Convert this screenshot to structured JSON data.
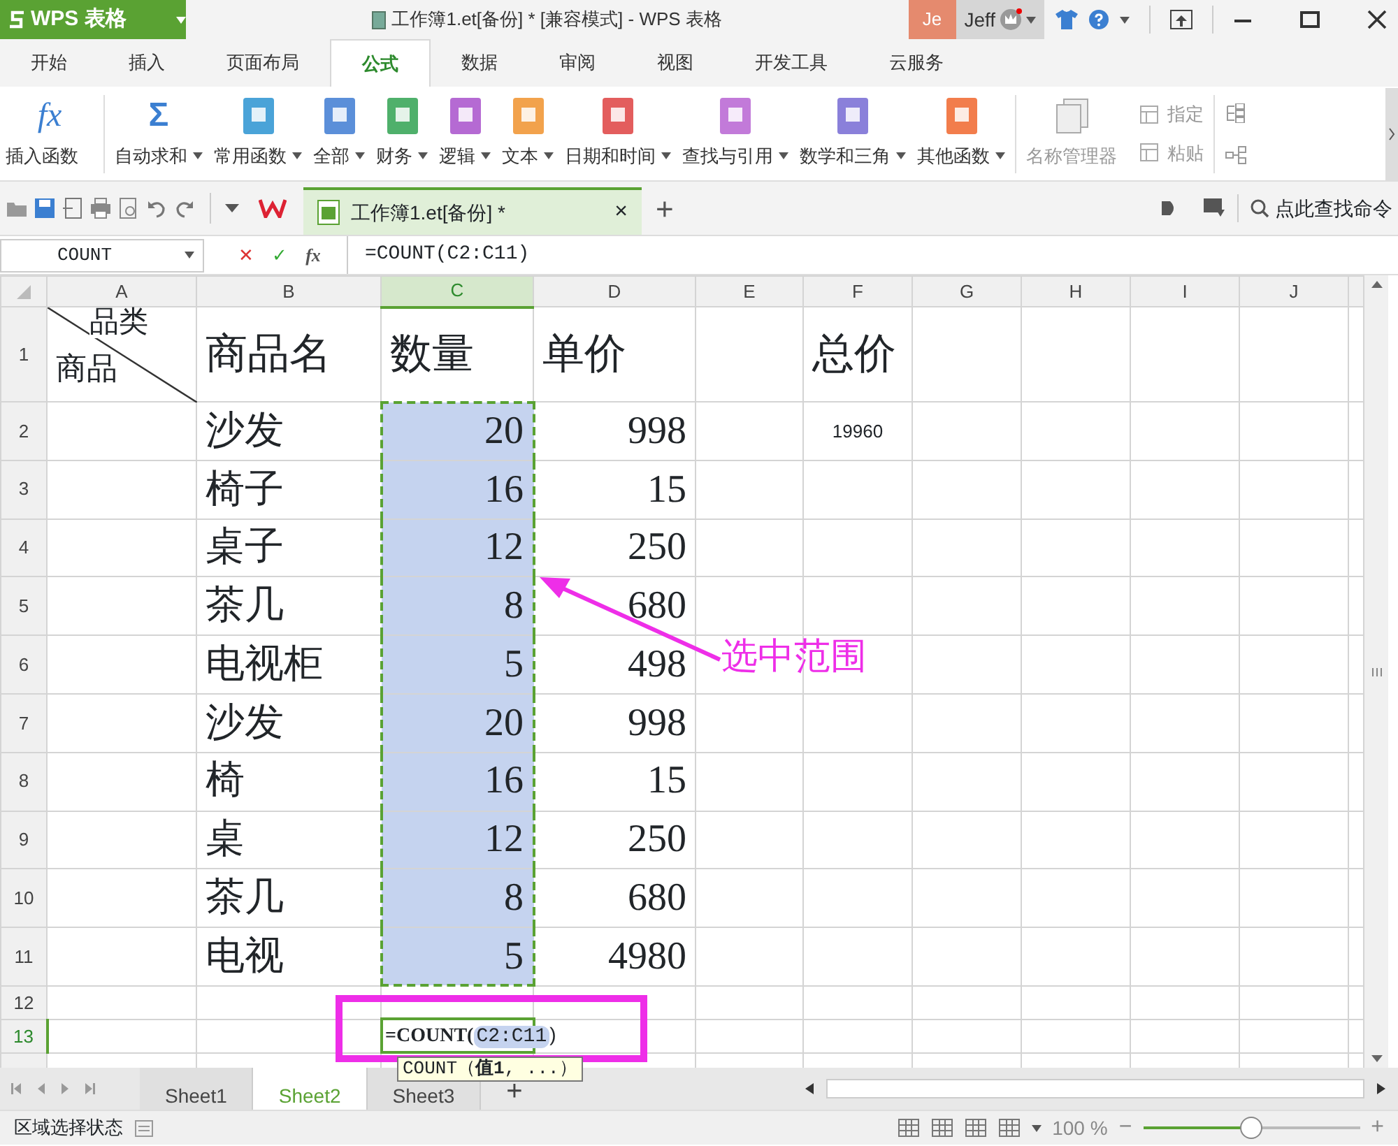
{
  "title_bar": {
    "app": "WPS 表格",
    "title": "工作簿1.et[备份] * [兼容模式] - WPS 表格",
    "avatar": "Je",
    "user": "Jeff"
  },
  "ribbon_tabs": [
    {
      "label": "开始",
      "selected": false
    },
    {
      "label": "插入",
      "selected": false
    },
    {
      "label": "页面布局",
      "selected": false
    },
    {
      "label": "公式",
      "selected": true
    },
    {
      "label": "数据",
      "selected": false
    },
    {
      "label": "审阅",
      "selected": false
    },
    {
      "label": "视图",
      "selected": false
    },
    {
      "label": "开发工具",
      "selected": false
    },
    {
      "label": "云服务",
      "selected": false
    }
  ],
  "ribbon": [
    {
      "kind": "fx",
      "glyph": "fx",
      "label": "插入函数",
      "dropdown": false
    },
    {
      "kind": "sum",
      "glyph": "Σ",
      "label": "自动求和",
      "dropdown": true
    },
    {
      "kind": "book",
      "label": "常用函数",
      "dropdown": true,
      "color": "#4aa3d8"
    },
    {
      "kind": "book",
      "label": "全部",
      "dropdown": true,
      "color": "#5b8fd9"
    },
    {
      "kind": "book",
      "label": "财务",
      "dropdown": true,
      "color": "#4fb06b"
    },
    {
      "kind": "book",
      "label": "逻辑",
      "dropdown": true,
      "color": "#b56ad3"
    },
    {
      "kind": "book",
      "label": "文本",
      "dropdown": true,
      "color": "#f2a24c"
    },
    {
      "kind": "book",
      "label": "日期和时间",
      "dropdown": true,
      "color": "#e35d5d"
    },
    {
      "kind": "book",
      "label": "查找与引用",
      "dropdown": true,
      "color": "#c27ad9"
    },
    {
      "kind": "book",
      "label": "数学和三角",
      "dropdown": true,
      "color": "#8a80da"
    },
    {
      "kind": "book",
      "label": "其他函数",
      "dropdown": true,
      "color": "#f27d4c"
    }
  ],
  "ribbon_disabled": {
    "manager": "名称管理器",
    "assign": "指定",
    "paste": "粘贴"
  },
  "doc_tab": {
    "title": "工作簿1.et[备份] *",
    "close": "×",
    "add": "+"
  },
  "command_search": "点此查找命令",
  "formula_bar": {
    "name_box": "COUNT",
    "cancel": "✕",
    "enter": "✓",
    "fx": "fx",
    "formula": "=COUNT(C2:C11)"
  },
  "columns": [
    {
      "label": "A",
      "selected": false
    },
    {
      "label": "B",
      "selected": false
    },
    {
      "label": "C",
      "selected": true
    },
    {
      "label": "D",
      "selected": false
    },
    {
      "label": "E",
      "selected": false
    },
    {
      "label": "F",
      "selected": false
    },
    {
      "label": "G",
      "selected": false
    },
    {
      "label": "H",
      "selected": false
    },
    {
      "label": "I",
      "selected": false
    },
    {
      "label": "J",
      "selected": false
    }
  ],
  "header_row": {
    "number": "1",
    "diagonal_top": "品类",
    "diagonal_bottom": "商品",
    "name": "商品名",
    "qty": "数量",
    "price": "单价",
    "total": "总价"
  },
  "rows": [
    {
      "number": "2",
      "name": "沙发",
      "qty": "20",
      "price": "998",
      "total": "19960"
    },
    {
      "number": "3",
      "name": "椅子",
      "qty": "16",
      "price": "15"
    },
    {
      "number": "4",
      "name": "桌子",
      "qty": "12",
      "price": "250"
    },
    {
      "number": "5",
      "name": "茶几",
      "qty": "8",
      "price": "680"
    },
    {
      "number": "6",
      "name": "电视柜",
      "qty": "5",
      "price": "498"
    },
    {
      "number": "7",
      "name": "沙发",
      "qty": "20",
      "price": "998"
    },
    {
      "number": "8",
      "name": "椅",
      "qty": "16",
      "price": "15"
    },
    {
      "number": "9",
      "name": "桌",
      "qty": "12",
      "price": "250"
    },
    {
      "number": "10",
      "name": "茶几",
      "qty": "8",
      "price": "680"
    },
    {
      "number": "11",
      "name": "电视",
      "qty": "5",
      "price": "4980"
    }
  ],
  "empty_rows": [
    {
      "number": "12",
      "selected": false
    },
    {
      "number": "13",
      "selected": true
    }
  ],
  "editing": {
    "prefix": "=COUNT(",
    "range": "C2:C11",
    "suffix": ")"
  },
  "tooltip": "COUNT（**值1**, ...）",
  "annotation": "选中范围",
  "sheets": [
    {
      "label": "Sheet1",
      "selected": false
    },
    {
      "label": "Sheet2",
      "selected": true
    },
    {
      "label": "Sheet3",
      "selected": false
    }
  ],
  "add_sheet": "+",
  "status_bar": {
    "mode": "区域选择状态",
    "zoom": "100 %",
    "zoom_slider": {
      "level": 0.5
    },
    "minus": "−",
    "plus": "+"
  }
}
